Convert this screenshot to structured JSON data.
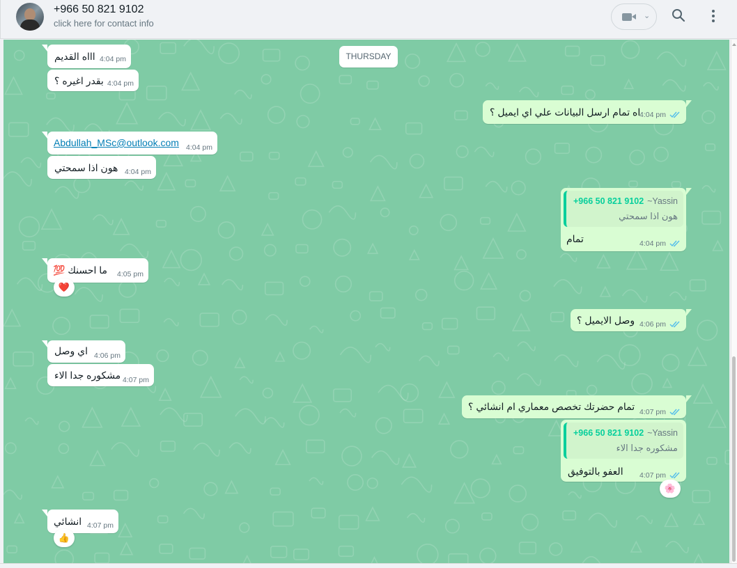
{
  "contact": {
    "name": "+966 50 821 9102",
    "subtitle": "click here for contact info"
  },
  "header_icons": [
    "video-call-icon",
    "chevron-down-icon",
    "search-icon",
    "menu-icon"
  ],
  "day_separator": "THURSDAY",
  "colors": {
    "chat_background": "#7fcba5",
    "incoming_bubble": "#ffffff",
    "outgoing_bubble": "#d9fdd3",
    "read_ticks": "#53bdeb",
    "quote_accent": "#06cf9c"
  },
  "messages": {
    "m1": {
      "text": "اااه القديم",
      "time": "4:04 pm"
    },
    "m2": {
      "text": "بقدر اغيره ؟",
      "time": "4:04 pm"
    },
    "m3": {
      "text": "اه تمام ارسل البيانات علي اي ايميل ؟",
      "time": "4:04 pm"
    },
    "m4": {
      "text": "Abdullah_MSc@outlook.com",
      "time": "4:04 pm"
    },
    "m5": {
      "text": "هون اذا سمحتي",
      "time": "4:04 pm"
    },
    "m6": {
      "quote_number": "+966 50 821 9102",
      "quote_name": "~Yassin",
      "quote_text": "هون اذا سمحتي",
      "text": "تمام",
      "time": "4:04 pm"
    },
    "m7": {
      "text": "ما احسنك 💯",
      "time": "4:05 pm",
      "reaction": "❤️"
    },
    "m8": {
      "text": "وصل الايميل ؟",
      "time": "4:06 pm"
    },
    "m9": {
      "text": "اي وصل",
      "time": "4:06 pm"
    },
    "m10": {
      "text": "مشكوره جدا الاء",
      "time": "4:07 pm"
    },
    "m11": {
      "text": "تمام حضرتك تخصص معماري ام انشائي ؟",
      "time": "4:07 pm"
    },
    "m12": {
      "quote_number": "+966 50 821 9102",
      "quote_name": "~Yassin",
      "quote_text": "مشكوره جدا الاء",
      "text": "العفو بالتوفيق",
      "time": "4:07 pm",
      "reaction": "🌸"
    },
    "m13": {
      "text": "انشائي",
      "time": "4:07 pm",
      "reaction": "👍"
    }
  }
}
